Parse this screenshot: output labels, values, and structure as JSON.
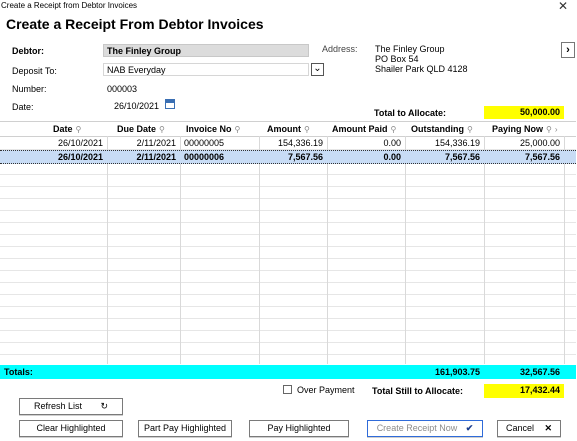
{
  "window": {
    "title": "Create a Receipt from Debtor Invoices"
  },
  "heading": "Create a Receipt From Debtor Invoices",
  "form": {
    "debtor_label": "Debtor:",
    "debtor_value": "The Finley Group",
    "deposit_label": "Deposit To:",
    "deposit_value": "NAB Everyday",
    "number_label": "Number:",
    "number_value": "000003",
    "date_label": "Date:",
    "date_value": "26/10/2021",
    "address_label": "Address:",
    "address_lines": [
      "The Finley Group",
      "PO Box 54",
      "Shailer Park QLD 4128"
    ]
  },
  "allocate": {
    "label": "Total to Allocate:",
    "value": "50,000.00"
  },
  "grid": {
    "columns": [
      "Date",
      "Due Date",
      "Invoice No",
      "Amount",
      "Amount Paid",
      "Outstanding",
      "Paying Now"
    ],
    "rows": [
      {
        "date": "26/10/2021",
        "due": "2/11/2021",
        "invoice": "00000005",
        "amount": "154,336.19",
        "paid": "0.00",
        "outstanding": "154,336.19",
        "paying": "25,000.00",
        "selected": false
      },
      {
        "date": "26/10/2021",
        "due": "2/11/2021",
        "invoice": "00000006",
        "amount": "7,567.56",
        "paid": "0.00",
        "outstanding": "7,567.56",
        "paying": "7,567.56",
        "selected": true
      }
    ],
    "totals_label": "Totals:",
    "total_outstanding": "161,903.75",
    "total_paying": "32,567.56"
  },
  "footer": {
    "over_payment_label": "Over Payment",
    "still_label": "Total Still to Allocate:",
    "still_value": "17,432.44"
  },
  "buttons": {
    "refresh": "Refresh List",
    "clear": "Clear Highlighted",
    "part_pay": "Part Pay Highlighted",
    "pay": "Pay Highlighted",
    "create": "Create Receipt Now",
    "cancel": "Cancel"
  },
  "colors": {
    "totals_bar": "#00ffff",
    "highlight": "#ffff00",
    "selected_row": "#c8dcf5"
  }
}
